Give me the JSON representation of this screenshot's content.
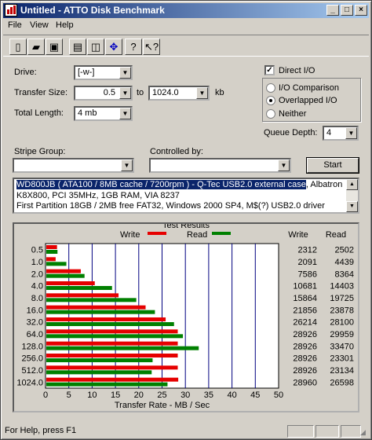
{
  "window": {
    "title": "Untitled - ATTO Disk Benchmark",
    "caption_buttons": [
      "_",
      "□",
      "×"
    ]
  },
  "menu": [
    "File",
    "View",
    "Help"
  ],
  "toolbar": {
    "icons": [
      "new-document-icon",
      "open-folder-icon",
      "save-icon",
      "print-icon",
      "print-preview-icon",
      "move-cross-icon",
      "help-icon",
      "context-help-icon"
    ]
  },
  "form": {
    "drive_label": "Drive:",
    "drive_value": "[-w-]",
    "transfer_size_label": "Transfer Size:",
    "transfer_from": "0.5",
    "to_label": "to",
    "transfer_to": "1024.0",
    "kb_label": "kb",
    "total_length_label": "Total Length:",
    "total_length_value": "4 mb",
    "direct_io_label": "Direct I/O",
    "direct_io_checked": true,
    "io_options": [
      {
        "label": "I/O Comparison",
        "selected": false
      },
      {
        "label": "Overlapped I/O",
        "selected": true
      },
      {
        "label": "Neither",
        "selected": false
      }
    ],
    "queue_depth_label": "Queue Depth:",
    "queue_depth_value": "4",
    "stripe_group_label": "Stripe Group:",
    "controlled_by_label": "Controlled by:",
    "start_button": "Start"
  },
  "description": {
    "line1_highlight": "WD800JB ( ATA100 / 8MB cache / 7200rpm ) - Q-Tec USB2.0 external case",
    "line1_rest": ", Albatron",
    "line2": "K8X800, PCI 35MHz, 1GB RAM, VIA 8237",
    "line3": "First Partition 18GB / 2MB free FAT32, Windows 2000 SP4, M$(?) USB2.0 driver"
  },
  "chart_data": {
    "type": "bar",
    "title": "Test Results",
    "xlabel": "Transfer Rate - MB / Sec",
    "xlim": [
      0,
      50
    ],
    "xticks": [
      0,
      5,
      10,
      15,
      20,
      25,
      30,
      35,
      40,
      45,
      50
    ],
    "categories": [
      "0.5",
      "1.0",
      "2.0",
      "4.0",
      "8.0",
      "16.0",
      "32.0",
      "64.0",
      "128.0",
      "256.0",
      "512.0",
      "1024.0"
    ],
    "series": [
      {
        "name": "Write",
        "color": "#e60000",
        "values": [
          2.3,
          2.0,
          7.4,
          10.4,
          15.5,
          21.3,
          25.6,
          28.2,
          28.2,
          28.2,
          28.2,
          28.3
        ]
      },
      {
        "name": "Read",
        "color": "#008000",
        "values": [
          2.4,
          4.3,
          8.2,
          14.1,
          19.3,
          23.3,
          27.4,
          29.3,
          32.7,
          22.8,
          22.6,
          26.0
        ]
      }
    ],
    "table": {
      "headers": [
        "Write",
        "Read"
      ],
      "write": [
        "2312",
        "2091",
        "7586",
        "10681",
        "15864",
        "21856",
        "26214",
        "28926",
        "28926",
        "28926",
        "28926",
        "28960"
      ],
      "read": [
        "2502",
        "4439",
        "8364",
        "14403",
        "19725",
        "23878",
        "28100",
        "29959",
        "33470",
        "23301",
        "23134",
        "26598"
      ]
    }
  },
  "status": {
    "text": "For Help, press F1"
  }
}
